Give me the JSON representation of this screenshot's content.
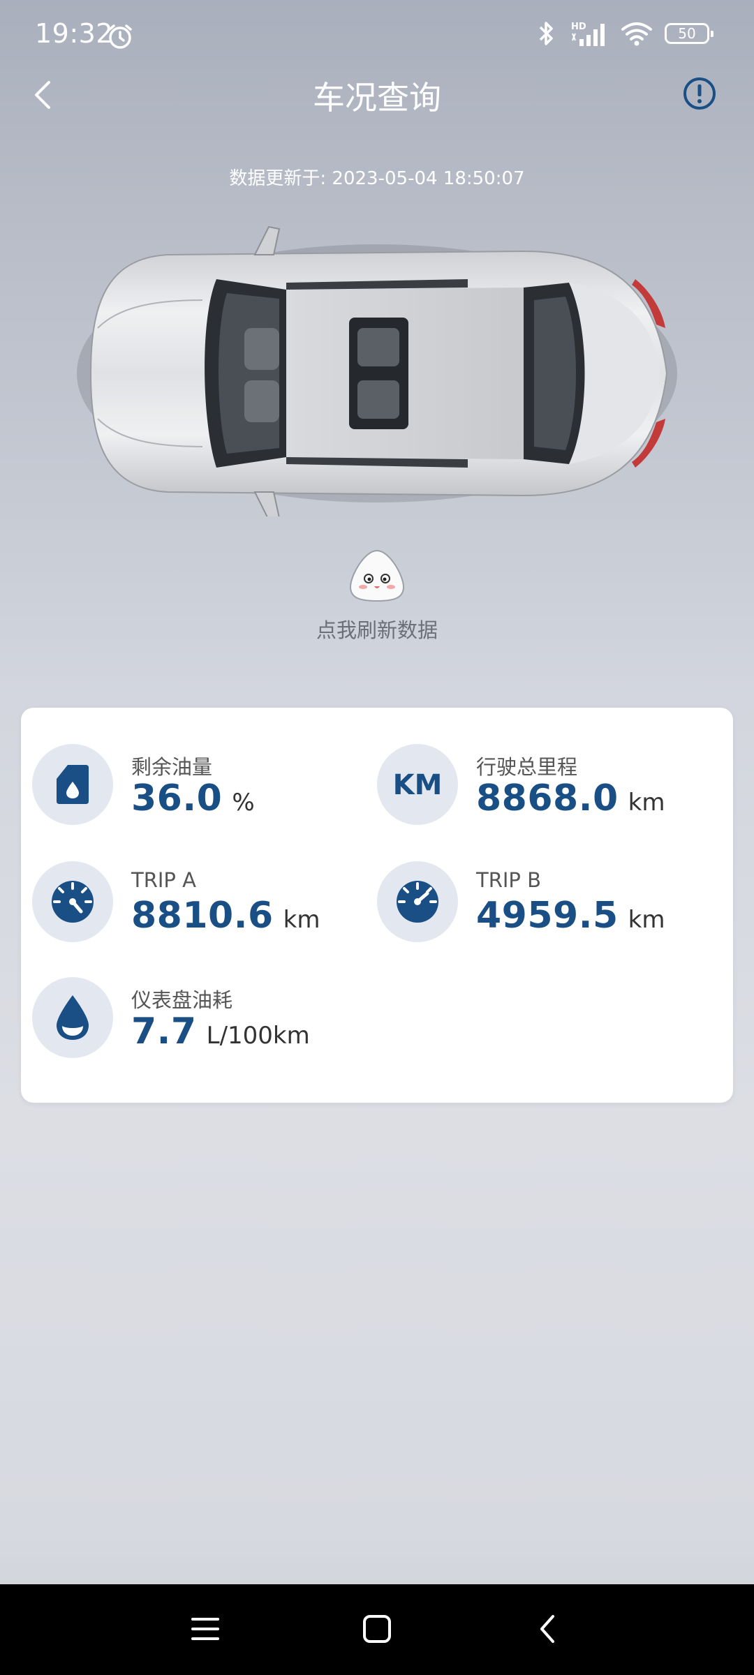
{
  "status_bar": {
    "time": "19:32",
    "battery": "50",
    "icons": [
      "alarm-icon",
      "bluetooth-icon",
      "hd-signal-icon",
      "wifi-icon",
      "battery-icon"
    ]
  },
  "header": {
    "title": "车况查询",
    "back_icon": "chevron-left-icon",
    "info_icon": "exclamation-circle-icon"
  },
  "update_time": "数据更新于: 2023-05-04 18:50:07",
  "refresh": {
    "label": "点我刷新数据"
  },
  "metrics": {
    "fuel": {
      "label": "剩余油量",
      "value": "36.0",
      "unit": "%",
      "icon": "fuel-tank-icon"
    },
    "odometer": {
      "label": "行驶总里程",
      "value": "8868.0",
      "unit": "km",
      "icon": "km-icon"
    },
    "trip_a": {
      "label": "TRIP A",
      "value": "8810.6",
      "unit": "km",
      "icon": "speedometer-icon"
    },
    "trip_b": {
      "label": "TRIP B",
      "value": "4959.5",
      "unit": "km",
      "icon": "gauge-icon"
    },
    "consumption": {
      "label": "仪表盘油耗",
      "value": "7.7",
      "unit": "L/100km",
      "icon": "fuel-drop-icon"
    }
  },
  "colors": {
    "accent": "#1a4f86",
    "icon_bg": "#e3e8f0",
    "card_bg": "#ffffff"
  },
  "nav_bar": {
    "icons": [
      "menu-icon",
      "home-icon",
      "back-icon"
    ]
  }
}
